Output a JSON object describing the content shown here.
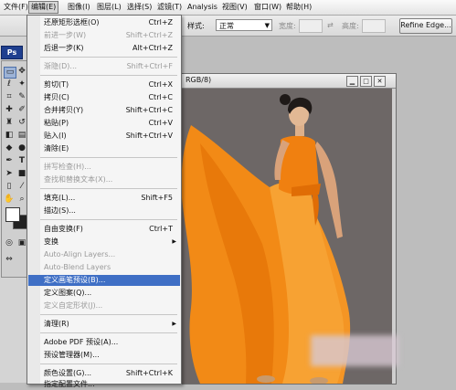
{
  "menubar": {
    "items": [
      {
        "label": "文件(F)"
      },
      {
        "label": "编辑(E)"
      },
      {
        "label": "图像(I)"
      },
      {
        "label": "图层(L)"
      },
      {
        "label": "选择(S)"
      },
      {
        "label": "滤镜(T)"
      },
      {
        "label": "Analysis"
      },
      {
        "label": "视图(V)"
      },
      {
        "label": "窗口(W)"
      },
      {
        "label": "帮助(H)"
      }
    ]
  },
  "options": {
    "style_label": "样式:",
    "style_value": "正常",
    "width_label": "宽度:",
    "height_label": "高度:",
    "refine_edge": "Refine Edge..."
  },
  "app": {
    "logo": "Ps"
  },
  "document": {
    "title": "RGB/8)"
  },
  "edit_menu": {
    "items": [
      {
        "label": "还原矩形选框(O)",
        "shortcut": "Ctrl+Z",
        "disabled": false
      },
      {
        "label": "前进一步(W)",
        "shortcut": "Shift+Ctrl+Z",
        "disabled": true
      },
      {
        "label": "后退一步(K)",
        "shortcut": "Alt+Ctrl+Z",
        "disabled": false
      },
      {
        "label": "渐隐(D)...",
        "shortcut": "Shift+Ctrl+F",
        "disabled": true
      },
      {
        "label": "剪切(T)",
        "shortcut": "Ctrl+X",
        "disabled": false
      },
      {
        "label": "拷贝(C)",
        "shortcut": "Ctrl+C",
        "disabled": false
      },
      {
        "label": "合并拷贝(Y)",
        "shortcut": "Shift+Ctrl+C",
        "disabled": false
      },
      {
        "label": "粘贴(P)",
        "shortcut": "Ctrl+V",
        "disabled": false
      },
      {
        "label": "贴入(I)",
        "shortcut": "Shift+Ctrl+V",
        "disabled": false
      },
      {
        "label": "清除(E)",
        "shortcut": "",
        "disabled": false
      },
      {
        "label": "拼写检查(H)...",
        "shortcut": "",
        "disabled": true
      },
      {
        "label": "查找和替换文本(X)...",
        "shortcut": "",
        "disabled": true
      },
      {
        "label": "填充(L)...",
        "shortcut": "Shift+F5",
        "disabled": false
      },
      {
        "label": "描边(S)...",
        "shortcut": "",
        "disabled": false
      },
      {
        "label": "自由变换(F)",
        "shortcut": "Ctrl+T",
        "disabled": false
      },
      {
        "label": "变换",
        "shortcut": "",
        "disabled": false,
        "submenu": true
      },
      {
        "label": "Auto-Align Layers...",
        "shortcut": "",
        "disabled": true
      },
      {
        "label": "Auto-Blend Layers",
        "shortcut": "",
        "disabled": true
      },
      {
        "label": "定义画笔预设(B)...",
        "shortcut": "",
        "disabled": false,
        "highlighted": true
      },
      {
        "label": "定义图案(Q)...",
        "shortcut": "",
        "disabled": false
      },
      {
        "label": "定义自定形状(J)...",
        "shortcut": "",
        "disabled": true
      },
      {
        "label": "清理(R)",
        "shortcut": "",
        "disabled": false,
        "submenu": true
      },
      {
        "label": "Adobe PDF 预设(A)...",
        "shortcut": "",
        "disabled": false
      },
      {
        "label": "预设管理器(M)...",
        "shortcut": "",
        "disabled": false
      },
      {
        "label": "颜色设置(G)...",
        "shortcut": "Shift+Ctrl+K",
        "disabled": false
      },
      {
        "label": "指定配置文件...",
        "shortcut": "",
        "disabled": false
      }
    ]
  },
  "colors": {
    "highlight": "#3f6fc5",
    "dress": "#f28a16",
    "canvas_bg": "#6d6766"
  },
  "icons": [
    "marquee-tool-icon",
    "move-tool-icon",
    "lasso-tool-icon",
    "magic-wand-icon",
    "crop-tool-icon",
    "slice-tool-icon",
    "healing-brush-icon",
    "brush-tool-icon",
    "clone-stamp-icon",
    "history-brush-icon",
    "eraser-tool-icon",
    "gradient-tool-icon",
    "blur-tool-icon",
    "dodge-tool-icon",
    "pen-tool-icon",
    "type-tool-icon",
    "path-selection-icon",
    "shape-tool-icon",
    "notes-tool-icon",
    "eyedropper-icon",
    "hand-tool-icon",
    "zoom-tool-icon"
  ]
}
